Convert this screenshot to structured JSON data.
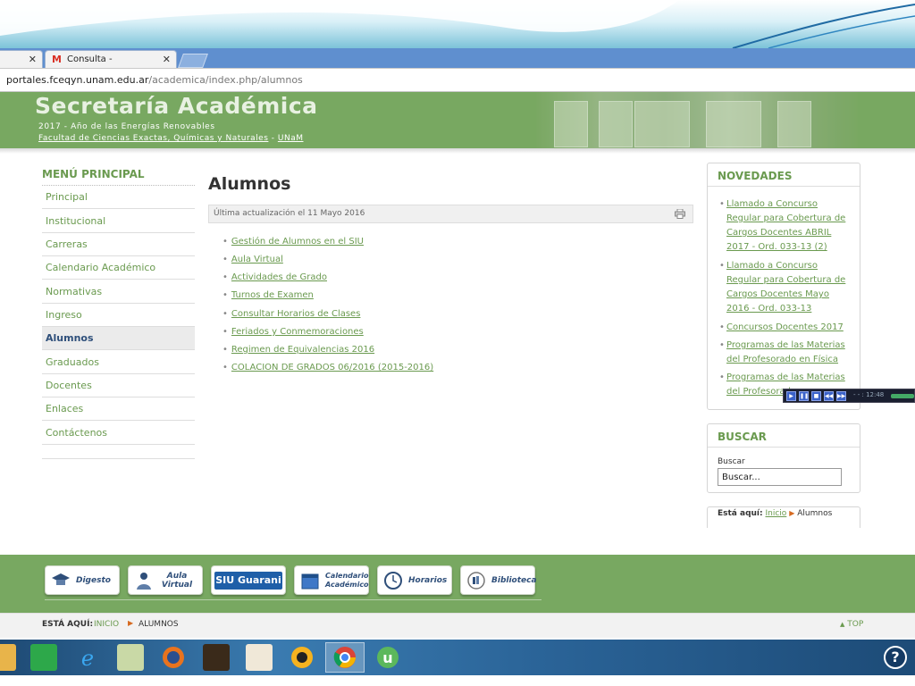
{
  "browser": {
    "tabs": [
      {
        "label": ""
      },
      {
        "label": "Consulta - icososa@gma"
      }
    ],
    "url_host": "portales.fceqyn.unam.edu.ar",
    "url_path": "/academica/index.php/alumnos"
  },
  "site": {
    "title": "Secretaría Académica",
    "subtitle_year": "2017 - Año de las Energías Renovables",
    "faculty_link": "Facultad de Ciencias Exactas, Químicas y Naturales",
    "separator": " - ",
    "university_link": "UNaM"
  },
  "menu": {
    "title": "MENÚ PRINCIPAL",
    "items": [
      {
        "label": "Principal"
      },
      {
        "label": "Institucional"
      },
      {
        "label": "Carreras"
      },
      {
        "label": "Calendario Académico"
      },
      {
        "label": "Normativas"
      },
      {
        "label": "Ingreso"
      },
      {
        "label": "Alumnos",
        "active": true
      },
      {
        "label": "Graduados"
      },
      {
        "label": "Docentes"
      },
      {
        "label": "Enlaces"
      },
      {
        "label": "Contáctenos"
      }
    ]
  },
  "content": {
    "title": "Alumnos",
    "last_update": "Última actualización el 11 Mayo 2016",
    "links": [
      {
        "label": "Gestión de Alumnos en el SIU"
      },
      {
        "label": "Aula Virtual"
      },
      {
        "label": "Actividades de Grado"
      },
      {
        "label": "Turnos de Examen"
      },
      {
        "label": "Consultar Horarios de Clases"
      },
      {
        "label": "Feriados y Conmemoraciones"
      },
      {
        "label": "Regimen de Equivalencias 2016"
      },
      {
        "label": "COLACION DE GRADOS 06/2016 (2015-2016)"
      }
    ]
  },
  "novedades": {
    "title": "NOVEDADES",
    "items": [
      {
        "label": "Llamado a Concurso Regular para Cobertura de Cargos Docentes ABRIL 2017 - Ord. 033-13 (2)"
      },
      {
        "label": "Llamado a Concurso Regular para Cobertura de Cargos Docentes Mayo 2016 - Ord. 033-13"
      },
      {
        "label": "Concursos Docentes 2017"
      },
      {
        "label": "Programas de las Materias del Profesorado en Física"
      },
      {
        "label": "Programas de las Materias del Profesorado e"
      }
    ]
  },
  "search": {
    "title": "BUSCAR",
    "label": "Buscar",
    "value": "Buscar..."
  },
  "breadcrumb_box": {
    "label": "Está aquí:",
    "home": "Inicio",
    "current": "Alumnos"
  },
  "media_player": {
    "time": "- - : 12:48"
  },
  "footer": {
    "buttons": [
      {
        "label": "Digesto",
        "icon": "graduation-cap-icon"
      },
      {
        "label": "Aula Virtual",
        "icon": "student-icon"
      },
      {
        "label": "SIU Guarani",
        "icon": "siu-guarani-logo"
      },
      {
        "label": "Calendario Académico",
        "icon": "calendar-icon"
      },
      {
        "label": "Horarios",
        "icon": "clock-icon"
      },
      {
        "label": "Biblioteca",
        "icon": "library-icon"
      }
    ],
    "breadcrumb_label": "ESTÁ AQUÍ:",
    "breadcrumb_home": "INICIO",
    "breadcrumb_current": "ALUMNOS",
    "top_link": "TOP"
  },
  "colors": {
    "brand_green": "#78a861",
    "link_green": "#6a9a4f",
    "active_menu": "#2e4f7a"
  }
}
